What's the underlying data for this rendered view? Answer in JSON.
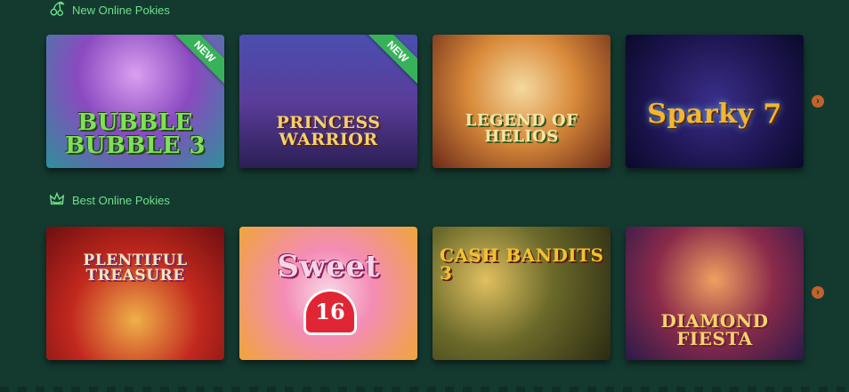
{
  "sections": [
    {
      "title": "New Online Pokies",
      "icon": "cherries-icon",
      "games": [
        {
          "name": "BUBBLE BUBBLE 3",
          "badge": "NEW"
        },
        {
          "name": "PRINCESS WARRIOR",
          "badge": "NEW"
        },
        {
          "name": "LEGEND OF HELIOS",
          "badge": ""
        },
        {
          "name": "Sparky 7",
          "badge": ""
        }
      ],
      "next_arrow": "›"
    },
    {
      "title": "Best Online Pokies",
      "icon": "crown-icon",
      "games": [
        {
          "name": "PLENTIFUL TREASURE",
          "badge": ""
        },
        {
          "name": "Sweet",
          "badge": "",
          "number": "16"
        },
        {
          "name": "CASH BANDITS 3",
          "badge": ""
        },
        {
          "name": "DIAMOND FIESTA",
          "badge": ""
        }
      ],
      "next_arrow": "›"
    }
  ],
  "colors": {
    "background": "#143a30",
    "section_title": "#6fe08a",
    "new_ribbon": "#38b25a",
    "arrow": "#c2622a"
  }
}
